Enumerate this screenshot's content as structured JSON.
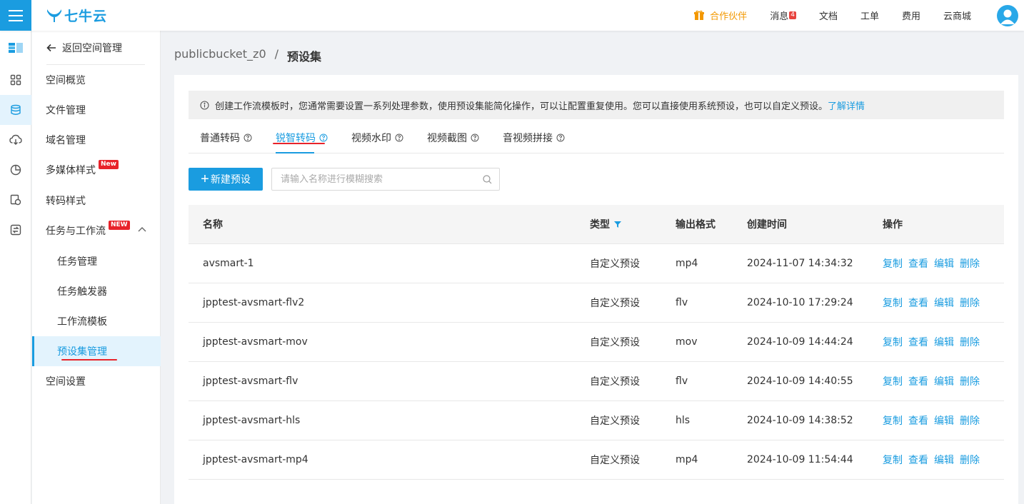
{
  "header": {
    "logo_text": "七牛云",
    "partner": "合作伙伴",
    "messages": "消息",
    "message_count": "4",
    "docs": "文档",
    "tickets": "工单",
    "billing": "费用",
    "marketplace": "云商城"
  },
  "sidebar": {
    "back": "返回空间管理",
    "items": [
      {
        "label": "空间概览"
      },
      {
        "label": "文件管理"
      },
      {
        "label": "域名管理"
      },
      {
        "label": "多媒体样式",
        "tag": "New"
      },
      {
        "label": "转码样式"
      },
      {
        "label": "任务与工作流",
        "tag": "NEW"
      },
      {
        "label": "任务管理"
      },
      {
        "label": "任务触发器"
      },
      {
        "label": "工作流模板"
      },
      {
        "label": "预设集管理"
      },
      {
        "label": "空间设置"
      }
    ]
  },
  "breadcrumb": {
    "bucket": "publicbucket_z0",
    "separator": "/",
    "current": "预设集"
  },
  "info": {
    "text": "创建工作流模板时，您通常需要设置一系列处理参数，使用预设集能简化操作，可以让配置重复使用。您可以直接使用系统预设，也可以自定义预设。",
    "link": "了解详情"
  },
  "tabs": [
    {
      "label": "普通转码"
    },
    {
      "label": "锐智转码"
    },
    {
      "label": "视频水印"
    },
    {
      "label": "视频截图"
    },
    {
      "label": "音视频拼接"
    }
  ],
  "toolbar": {
    "new_label": "新建预设",
    "search_placeholder": "请输入名称进行模糊搜索"
  },
  "table": {
    "columns": [
      "名称",
      "类型",
      "输出格式",
      "创建时间",
      "操作"
    ],
    "actions": [
      "复制",
      "查看",
      "编辑",
      "删除"
    ],
    "rows": [
      {
        "name": "avsmart-1",
        "type": "自定义预设",
        "format": "mp4",
        "created": "2024-11-07 14:34:32"
      },
      {
        "name": "jpptest-avsmart-flv2",
        "type": "自定义预设",
        "format": "flv",
        "created": "2024-10-10 17:29:24"
      },
      {
        "name": "jpptest-avsmart-mov",
        "type": "自定义预设",
        "format": "mov",
        "created": "2024-10-09 14:44:24"
      },
      {
        "name": "jpptest-avsmart-flv",
        "type": "自定义预设",
        "format": "flv",
        "created": "2024-10-09 14:40:55"
      },
      {
        "name": "jpptest-avsmart-hls",
        "type": "自定义预设",
        "format": "hls",
        "created": "2024-10-09 14:38:52"
      },
      {
        "name": "jpptest-avsmart-mp4",
        "type": "自定义预设",
        "format": "mp4",
        "created": "2024-10-09 11:54:44"
      }
    ]
  },
  "colors": {
    "accent": "#1a9ce0",
    "partner": "#f39800",
    "highlight": "#e8232a"
  }
}
